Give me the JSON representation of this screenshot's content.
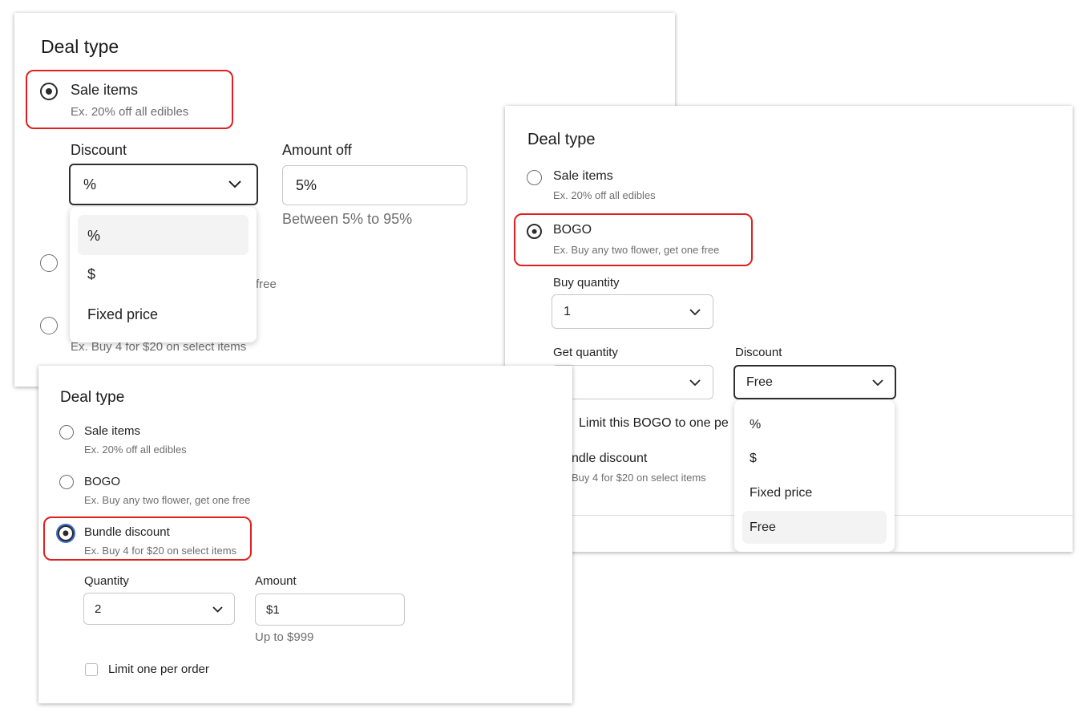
{
  "panel1": {
    "title": "Deal type",
    "sale_items_label": "Sale items",
    "sale_items_desc": "Ex. 20% off all edibles",
    "discount_label": "Discount",
    "discount_value": "%",
    "amount_off_label": "Amount off",
    "amount_off_value": "5%",
    "amount_off_helper": "Between 5% to 95%",
    "bogo_desc_partial": "free",
    "bundle_desc": "Ex. Buy 4 for $20 on select items",
    "menu_options": [
      "%",
      "$",
      "Fixed price"
    ]
  },
  "panel2": {
    "title": "Deal type",
    "sale_items_label": "Sale items",
    "sale_items_desc": "Ex. 20% off all edibles",
    "bogo_label": "BOGO",
    "bogo_desc": "Ex. Buy any two flower, get one free",
    "buy_qty_label": "Buy quantity",
    "buy_qty_value": "1",
    "get_qty_label": "Get quantity",
    "discount_label": "Discount",
    "discount_value": "Free",
    "limit_label_partial": "Limit this BOGO to one pe",
    "bundle_label_partial": "ndle discount",
    "bundle_desc_partial": "Buy 4 for $20 on select items",
    "menu_options": [
      "%",
      "$",
      "Fixed price",
      "Free"
    ]
  },
  "panel3": {
    "title": "Deal type",
    "sale_items_label": "Sale items",
    "sale_items_desc": "Ex. 20% off all edibles",
    "bogo_label": "BOGO",
    "bogo_desc": "Ex. Buy any two flower, get one free",
    "bundle_label": "Bundle discount",
    "bundle_desc": "Ex. Buy 4 for $20 on select items",
    "quantity_label": "Quantity",
    "quantity_value": "2",
    "amount_label": "Amount",
    "amount_value": "$1",
    "amount_helper": "Up to $999",
    "limit_label": "Limit one per order"
  },
  "icons": {
    "radio": "radio-icon",
    "chevron": "chevron-down-icon",
    "checkbox": "checkbox-icon"
  },
  "colors": {
    "highlight": "#e02020",
    "focus_ring": "#3b6fd6"
  }
}
